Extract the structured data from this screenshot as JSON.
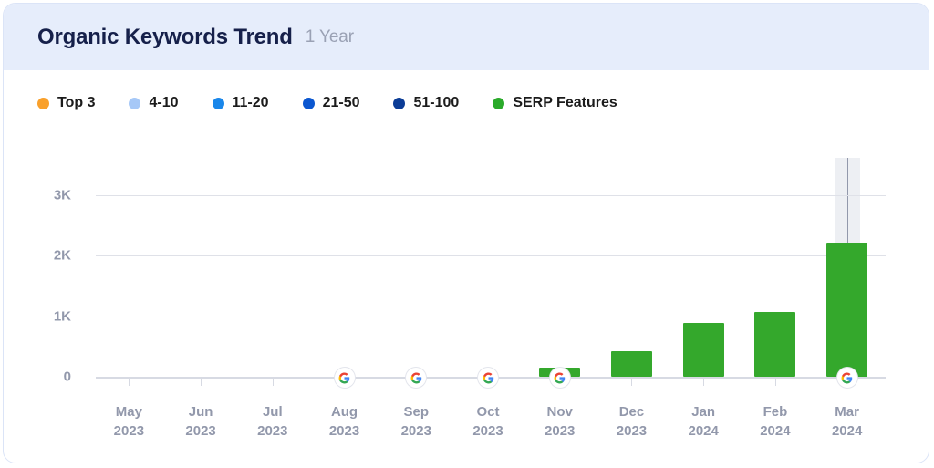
{
  "header": {
    "title": "Organic Keywords Trend",
    "subtitle": "1 Year"
  },
  "legend": {
    "items": [
      {
        "label": "Top 3",
        "color": "#f9a02b"
      },
      {
        "label": "4-10",
        "color": "#a6c8f7"
      },
      {
        "label": "11-20",
        "color": "#1a87ea"
      },
      {
        "label": "21-50",
        "color": "#0b57d0"
      },
      {
        "label": "51-100",
        "color": "#0b3c96"
      },
      {
        "label": "SERP Features",
        "color": "#2aaa2a"
      }
    ]
  },
  "chart_data": {
    "type": "bar",
    "title": "Organic Keywords Trend",
    "subtitle": "1 Year",
    "xlabel": "",
    "ylabel": "",
    "ylim": [
      0,
      3300
    ],
    "grid": true,
    "legend_position": "top-left",
    "y_ticks": [
      0,
      1000,
      2000,
      3000
    ],
    "y_tick_labels": [
      "0",
      "1K",
      "2K",
      "3K"
    ],
    "categories": [
      "May\n2023",
      "Jun\n2023",
      "Jul\n2023",
      "Aug\n2023",
      "Sep\n2023",
      "Oct\n2023",
      "Nov\n2023",
      "Dec\n2023",
      "Jan\n2024",
      "Feb\n2024",
      "Mar\n2024"
    ],
    "category_months": [
      "May",
      "Jun",
      "Jul",
      "Aug",
      "Sep",
      "Oct",
      "Nov",
      "Dec",
      "Jan",
      "Feb",
      "Mar"
    ],
    "category_years": [
      "2023",
      "2023",
      "2023",
      "2023",
      "2023",
      "2023",
      "2023",
      "2023",
      "2024",
      "2024",
      "2024"
    ],
    "series": [
      {
        "name": "SERP Features",
        "color": "#34a82c",
        "values": [
          0,
          0,
          0,
          0,
          0,
          0,
          150,
          420,
          890,
          1070,
          2220
        ]
      },
      {
        "name": "Top 3",
        "color": "#f9a02b",
        "values": [
          0,
          0,
          0,
          0,
          0,
          0,
          0,
          0,
          0,
          0,
          0
        ]
      },
      {
        "name": "4-10",
        "color": "#a6c8f7",
        "values": [
          0,
          0,
          0,
          0,
          0,
          0,
          0,
          0,
          0,
          0,
          0
        ]
      },
      {
        "name": "11-20",
        "color": "#1a87ea",
        "values": [
          0,
          0,
          0,
          0,
          0,
          0,
          0,
          0,
          0,
          0,
          0
        ]
      },
      {
        "name": "21-50",
        "color": "#0b57d0",
        "values": [
          0,
          0,
          0,
          0,
          0,
          0,
          0,
          0,
          0,
          0,
          0
        ]
      },
      {
        "name": "51-100",
        "color": "#0b3c96",
        "values": [
          0,
          0,
          0,
          0,
          0,
          0,
          0,
          0,
          0,
          0,
          0
        ]
      }
    ],
    "annotations": [
      {
        "type": "google-update-marker",
        "category": "Aug 2023"
      },
      {
        "type": "google-update-marker",
        "category": "Sep 2023"
      },
      {
        "type": "google-update-marker",
        "category": "Oct 2023"
      },
      {
        "type": "google-update-marker",
        "category": "Nov 2023"
      },
      {
        "type": "google-update-marker",
        "category": "Mar 2024"
      }
    ],
    "highlighted_category": "Mar 2024"
  }
}
